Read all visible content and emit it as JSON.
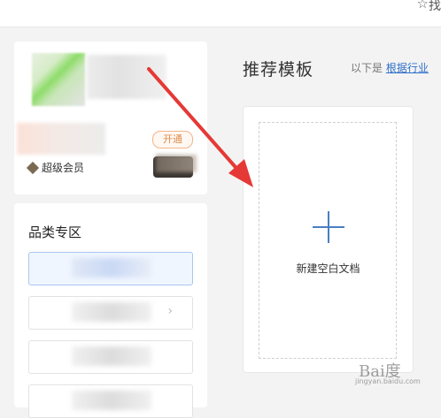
{
  "topbar": {
    "star_icon": "☆",
    "partial_text": "找"
  },
  "profile": {
    "vip_label": "超级会员",
    "open_badge": "开通"
  },
  "categories": {
    "title": "品类专区",
    "items": [
      {
        "label": "",
        "active": true
      },
      {
        "label": "",
        "active": false
      },
      {
        "label": "",
        "active": false
      },
      {
        "label": "",
        "active": false
      }
    ]
  },
  "main": {
    "title": "推荐模板",
    "subtitle_prefix": "以下是",
    "subtitle_link": "根据行业",
    "new_doc_label": "新建空白文档"
  },
  "colors": {
    "accent": "#2f6fc9",
    "arrow": "#e53935",
    "plus": "#4a7fc1"
  },
  "watermark": {
    "text": "Bai度",
    "url": "jingyan.baidu.com"
  }
}
